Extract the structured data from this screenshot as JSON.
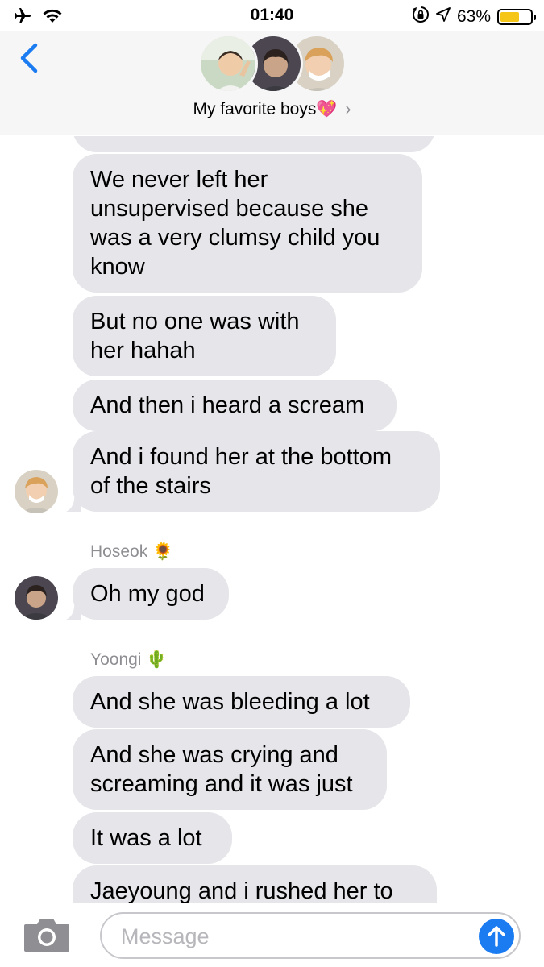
{
  "status_bar": {
    "time": "01:40",
    "battery_percent": "63%",
    "battery_level": 0.63,
    "icons": [
      "airplane-icon",
      "wifi-icon",
      "orientation-lock-icon",
      "location-icon",
      "battery-icon"
    ]
  },
  "header": {
    "group_title": "My favorite boys💖",
    "chevron": "›",
    "back_icon": "chevron-left-icon"
  },
  "messages": {
    "bubble_1": {
      "line_1": "We never left her",
      "line_2": "unsupervised because she",
      "line_3": "was a very clumsy child you",
      "line_4": "know"
    },
    "bubble_2": {
      "line_1": "But no one was with",
      "line_2": "her hahah"
    },
    "bubble_3": {
      "line_1": "And then i heard a scream"
    },
    "bubble_4": {
      "line_1": "And i found her at the bottom",
      "line_2": "of the stairs"
    },
    "sender_hoseok": "Hoseok 🌻",
    "bubble_5": {
      "line_1": "Oh my god"
    },
    "sender_yoongi": "Yoongi 🌵",
    "bubble_6": {
      "line_1": "And she was bleeding a lot"
    },
    "bubble_7": {
      "line_1": "And she was crying and",
      "line_2": "screaming and it was just"
    },
    "bubble_8": {
      "line_1": "It was a lot"
    },
    "bubble_9": {
      "line_1": "Jaeyoung and i rushed her to"
    }
  },
  "input_bar": {
    "placeholder": "Message",
    "camera_icon": "camera-icon",
    "send_icon": "arrow-up-icon"
  },
  "colors": {
    "bubble_gray": "#e5e5ea",
    "ios_blue": "#1b7cf2",
    "header_bg": "#f6f6f7",
    "battery_yellow": "#f5c518",
    "secondary_text": "#8e8e93"
  }
}
